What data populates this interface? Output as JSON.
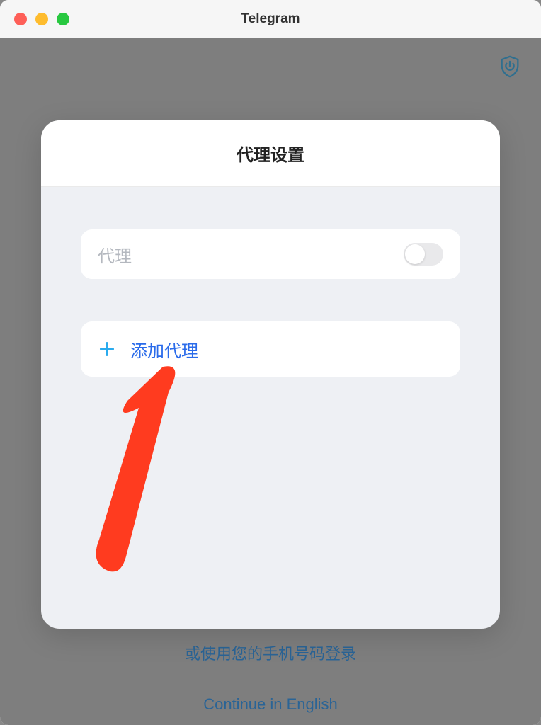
{
  "titlebar": {
    "title": "Telegram"
  },
  "background": {
    "phone_login_text": "或使用您的手机号码登录",
    "continue_english": "Continue in English"
  },
  "modal": {
    "title": "代理设置",
    "proxy_label": "代理",
    "add_label": "添加代理"
  }
}
